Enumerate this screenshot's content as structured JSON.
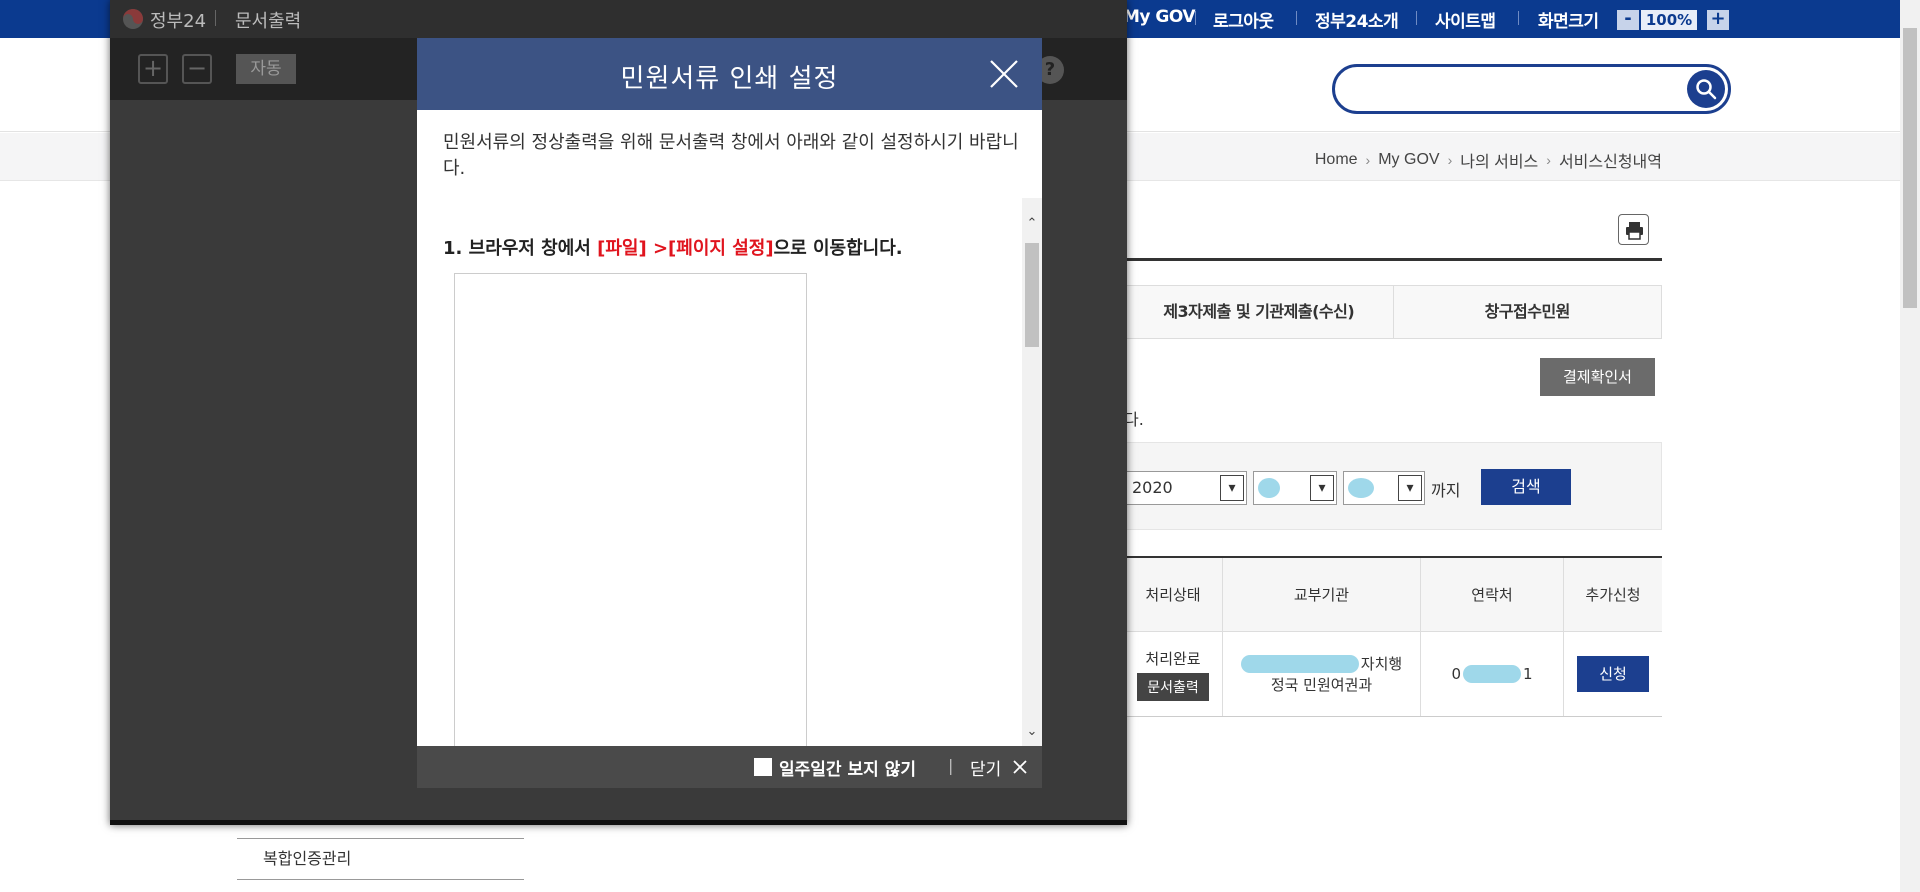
{
  "topbar": {
    "mygov": "My GOV",
    "logout": "로그아웃",
    "about": "정부24소개",
    "sitemap": "사이트맵",
    "screen_size": "화면크기",
    "zoom_minus": "-",
    "zoom_value": "100%",
    "zoom_plus": "+"
  },
  "breadcrumb": {
    "items": [
      "Home",
      "My GOV",
      "나의 서비스",
      "서비스신청내역"
    ]
  },
  "tabs": [
    "제3자제출 및 기관제출(수신)",
    "창구접수민원"
  ],
  "receipt_button": "결제확인서",
  "info_text_tail": "다.",
  "filter": {
    "year": "2020",
    "until": "까지",
    "search_button": "검색"
  },
  "results": {
    "headers": [
      "처리상태",
      "교부기관",
      "연락처",
      "추가신청"
    ],
    "row": {
      "status": "처리완료",
      "doc_output": "문서출력",
      "agency_line1": "자치행",
      "agency_line2": "정국 민원여권과",
      "phone_start": "0",
      "phone_end": "1",
      "apply": "신청"
    }
  },
  "left_menu": {
    "item": "복합인증관리"
  },
  "print_window": {
    "brand": "정부24",
    "title": "문서출력",
    "auto": "자동",
    "print": "인쇄",
    "help": "?",
    "zoom_in": "+",
    "zoom_out": "−"
  },
  "modal": {
    "title": "민원서류 인쇄 설정",
    "description": "민원서류의 정상출력을 위해 문서출력 창에서 아래와 같이 설정하시기 바랍니다.",
    "step1_prefix": "1. 브라우저 창에서 ",
    "step1_file": "[파일]",
    "step1_arrow": " >",
    "step1_page_setup": "[페이지 설정]",
    "step1_suffix": "으로 이동합니다.",
    "dont_show_week": "일주일간 보지 않기",
    "footer_sep": "|",
    "close": "닫기"
  },
  "colors": {
    "topbar": "#0b3a8f",
    "modal_header": "#3c5384",
    "accent_red": "#e0141e",
    "button_blue": "#1c3f8f"
  }
}
